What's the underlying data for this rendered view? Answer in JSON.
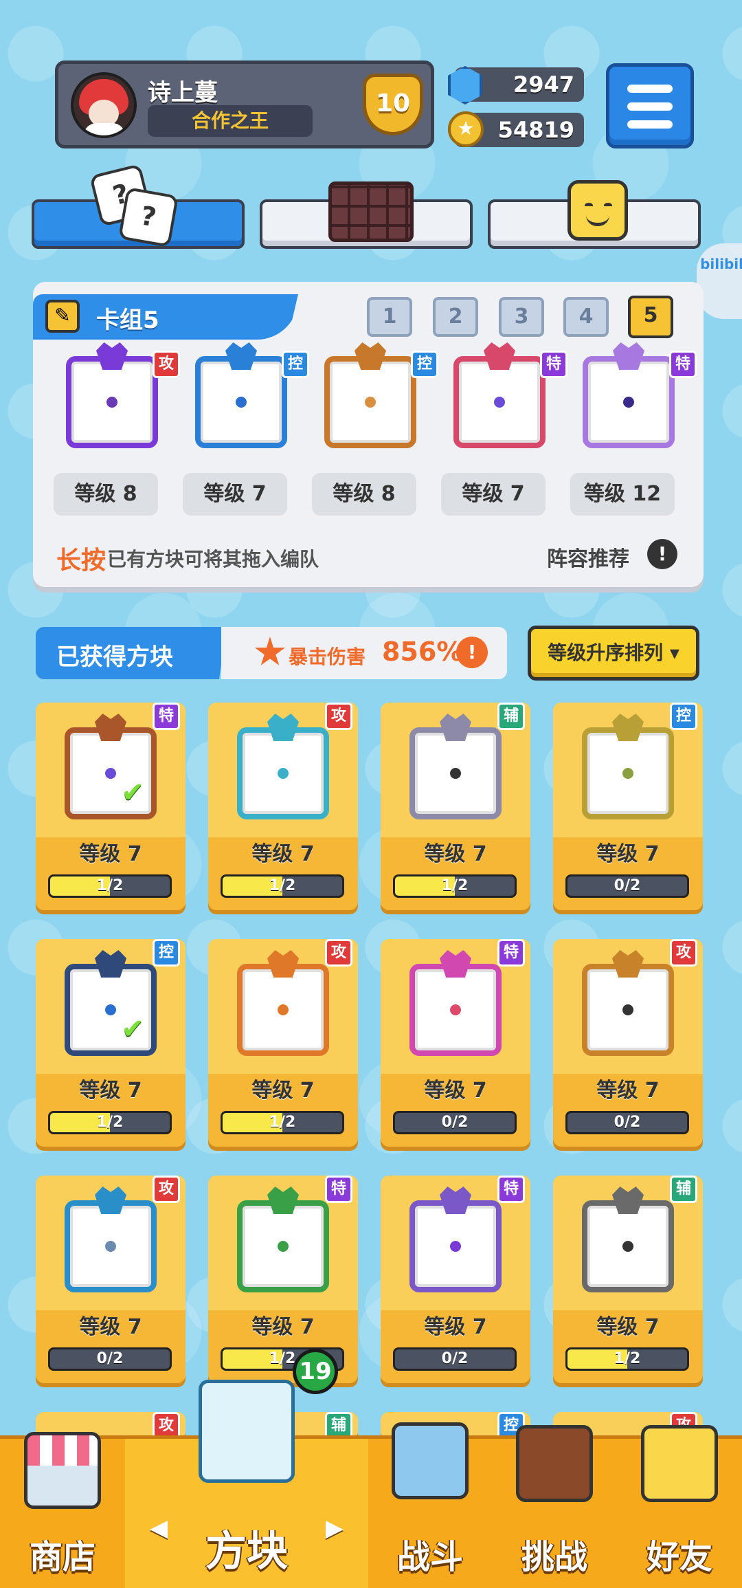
{
  "player": {
    "name": "诗上蔓",
    "title": "合作之王",
    "rank": "10"
  },
  "currency": {
    "gems": "2947",
    "coins": "54819"
  },
  "deck": {
    "title": "卡组5",
    "numbers": [
      "1",
      "2",
      "3",
      "4",
      "5"
    ],
    "selected": "5",
    "cards": [
      {
        "tag": "攻",
        "level": "等级 8",
        "color": "#7a3ad8",
        "dot": "#6b3ab5"
      },
      {
        "tag": "控",
        "level": "等级 7",
        "color": "#2a7fd6",
        "dot": "#2a6fd0"
      },
      {
        "tag": "控",
        "level": "等级 8",
        "color": "#c7782a",
        "dot": "#d89040"
      },
      {
        "tag": "特",
        "level": "等级 7",
        "color": "#d8486a",
        "dot": "#6a4ad8"
      },
      {
        "tag": "特",
        "level": "等级 12",
        "color": "#a678e0",
        "dot": "#3a2a8a"
      }
    ],
    "hint_emphasis": "长按",
    "hint_text": "已有方块可将其拖入编队",
    "recommend": "阵容推荐"
  },
  "owned": {
    "title": "已获得方块",
    "crit_label": "暴击伤害",
    "crit_value": "856%",
    "sort_label": "等级升序排列 ▾",
    "cards": [
      {
        "tag": "特",
        "level": "等级 7",
        "progress": "1/2",
        "fill": 0.5,
        "color": "#a8562a",
        "dot": "#6a4ad8",
        "in_deck": true
      },
      {
        "tag": "攻",
        "level": "等级 7",
        "progress": "1/2",
        "fill": 0.5,
        "color": "#3ab0c8",
        "dot": "#3ab0c8",
        "in_deck": false
      },
      {
        "tag": "辅",
        "level": "等级 7",
        "progress": "1/2",
        "fill": 0.5,
        "color": "#8c8aa8",
        "dot": "#333333",
        "in_deck": false
      },
      {
        "tag": "控",
        "level": "等级 7",
        "progress": "0/2",
        "fill": 0,
        "color": "#b8a036",
        "dot": "#8aa040",
        "in_deck": false
      },
      {
        "tag": "控",
        "level": "等级 7",
        "progress": "1/2",
        "fill": 0.5,
        "color": "#2f4a7a",
        "dot": "#2a6fd0",
        "in_deck": true
      },
      {
        "tag": "攻",
        "level": "等级 7",
        "progress": "1/2",
        "fill": 0.5,
        "color": "#e0782a",
        "dot": "#e0782a",
        "in_deck": false
      },
      {
        "tag": "特",
        "level": "等级 7",
        "progress": "0/2",
        "fill": 0,
        "color": "#d048b0",
        "dot": "#e04a6a",
        "in_deck": false
      },
      {
        "tag": "攻",
        "level": "等级 7",
        "progress": "0/2",
        "fill": 0,
        "color": "#c8822a",
        "dot": "#333333",
        "in_deck": false
      },
      {
        "tag": "攻",
        "level": "等级 7",
        "progress": "0/2",
        "fill": 0,
        "color": "#2a8ec8",
        "dot": "#6a8ab0",
        "in_deck": false
      },
      {
        "tag": "特",
        "level": "等级 7",
        "progress": "1/2",
        "fill": 0.5,
        "color": "#3aa048",
        "dot": "#3aa048",
        "in_deck": false
      },
      {
        "tag": "特",
        "level": "等级 7",
        "progress": "0/2",
        "fill": 0,
        "color": "#7a58c8",
        "dot": "#7a3ad8",
        "in_deck": false
      },
      {
        "tag": "辅",
        "level": "等级 7",
        "progress": "1/2",
        "fill": 0.5,
        "color": "#6a6a6a",
        "dot": "#333333",
        "in_deck": false
      }
    ],
    "partial_row_tags": [
      "攻",
      "辅",
      "控",
      "攻"
    ]
  },
  "nav": {
    "items": [
      "商店",
      "方块",
      "战斗",
      "挑战",
      "好友"
    ],
    "active": "方块",
    "notification": "19"
  },
  "watermark": "bilibili"
}
